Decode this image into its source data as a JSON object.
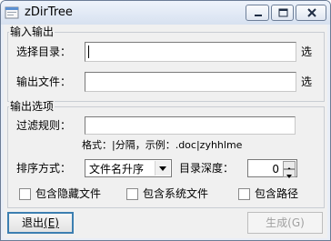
{
  "window": {
    "title": "zDirTree",
    "controls": [
      "minimize-icon",
      "maximize-icon",
      "close-icon"
    ]
  },
  "io_group": {
    "title": "输入输出",
    "select_dir_label": "选择目录：",
    "select_dir_value": "",
    "select_dir_button": "选",
    "output_file_label": "输出文件：",
    "output_file_value": "",
    "output_file_button": "选"
  },
  "options_group": {
    "title": "输出选项",
    "filter_label": "过滤规则：",
    "filter_value": "",
    "format_hint": "格式：|分隔，示例：.doc|zyhhlme",
    "sort_label": "排序方式：",
    "sort_value": "文件名升序",
    "depth_label": "目录深度：",
    "depth_value": "0",
    "include_hidden": {
      "label": "包含隐藏文件",
      "checked": false
    },
    "include_system": {
      "label": "包含系统文件",
      "checked": false
    },
    "include_path": {
      "label": "包含路径",
      "checked": false
    }
  },
  "buttons": {
    "exit_label": "退出",
    "exit_shortcut": "(E)",
    "generate_label": "生成(G)"
  }
}
